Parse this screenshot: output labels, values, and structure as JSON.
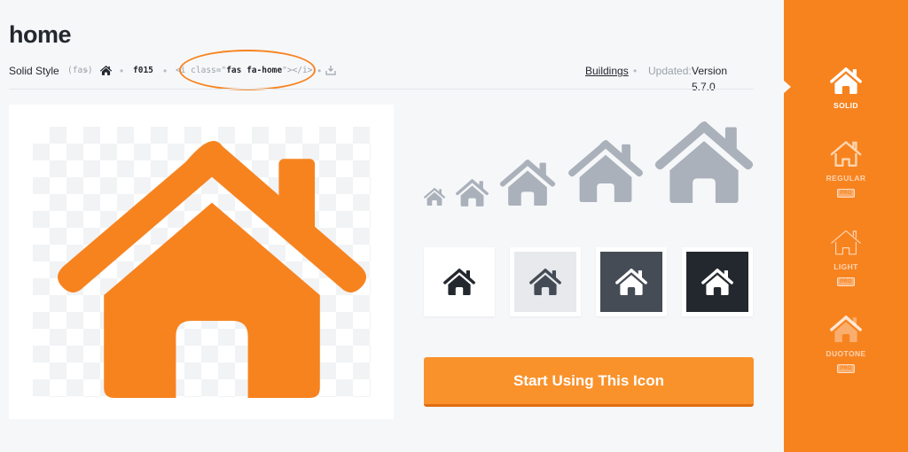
{
  "page": {
    "title": "home"
  },
  "meta": {
    "style_label": "Solid Style",
    "style_prefix": "(fas)",
    "unicode": "f015",
    "code_open": "<i class=\"",
    "code_class": "fas fa-home",
    "code_close": "\"></i>",
    "category": "Buildings",
    "updated_label": "Updated:",
    "version": "Version 5.7.0"
  },
  "sizes": [
    "xs",
    "sm",
    "lg",
    "2x",
    "3x"
  ],
  "swatches": [
    {
      "bg": "#ffffff",
      "fg": "#23282e"
    },
    {
      "bg": "#e7e9ec",
      "fg": "#444b54"
    },
    {
      "bg": "#454c55",
      "fg": "#ffffff"
    },
    {
      "bg": "#23282e",
      "fg": "#ffffff"
    }
  ],
  "cta": {
    "label": "Start Using This Icon"
  },
  "sidebar": {
    "styles": [
      {
        "label": "SOLID",
        "pro": "",
        "icon": "home-solid-icon"
      },
      {
        "label": "REGULAR",
        "pro": "PRO",
        "icon": "home-regular-icon"
      },
      {
        "label": "LIGHT",
        "pro": "PRO",
        "icon": "home-light-icon"
      },
      {
        "label": "DUOTONE",
        "pro": "PRO",
        "icon": "home-duotone-icon"
      }
    ]
  },
  "colors": {
    "brand": "#f7831f",
    "icon_gray": "#aab1ba",
    "text": "#23282e"
  }
}
